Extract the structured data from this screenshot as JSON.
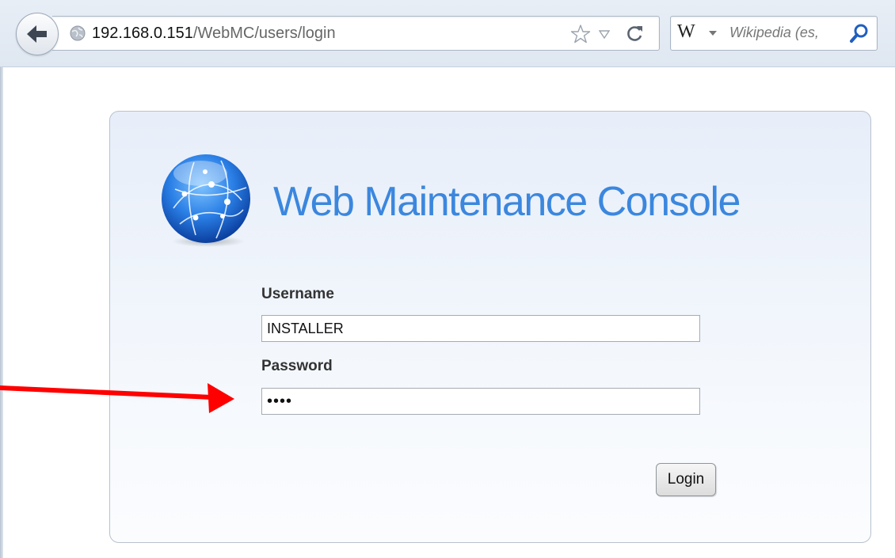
{
  "browser": {
    "url_host": "192.168.0.151",
    "url_path": "/WebMC/users/login",
    "search_engine_letter": "W",
    "search_placeholder": "Wikipedia (es,"
  },
  "login": {
    "title": "Web Maintenance Console",
    "username_label": "Username",
    "username_value": "INSTALLER",
    "password_label": "Password",
    "password_value": "1234",
    "login_button": "Login"
  },
  "colors": {
    "title_blue": "#3b87de",
    "arrow_red": "#ff0000"
  }
}
